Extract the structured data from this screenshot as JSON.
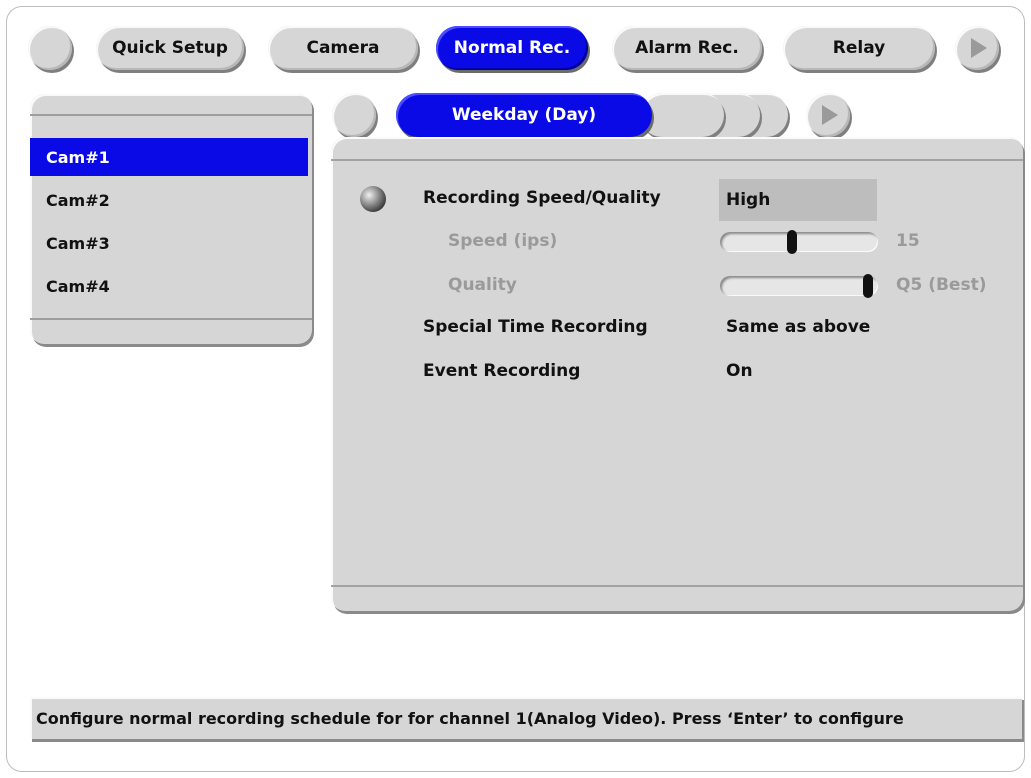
{
  "tabs": [
    {
      "label": "Quick Setup",
      "active": false
    },
    {
      "label": "Camera",
      "active": false
    },
    {
      "label": "Normal Rec.",
      "active": true
    },
    {
      "label": "Alarm Rec.",
      "active": false
    },
    {
      "label": "Relay",
      "active": false
    }
  ],
  "cameras": [
    {
      "label": "Cam#1",
      "selected": true
    },
    {
      "label": "Cam#2",
      "selected": false
    },
    {
      "label": "Cam#3",
      "selected": false
    },
    {
      "label": "Cam#4",
      "selected": false
    }
  ],
  "schedule_tabs": {
    "active_label": "Weekday (Day)"
  },
  "settings": {
    "recording_speed_quality": {
      "label": "Recording Speed/Quality",
      "value": "High"
    },
    "speed": {
      "label": "Speed (ips)",
      "value": "15",
      "level_percent": 45
    },
    "quality": {
      "label": "Quality",
      "value": "Q5 (Best)",
      "level_percent": 100
    },
    "special_time_recording": {
      "label": "Special Time Recording",
      "value": "Same as above"
    },
    "event_recording": {
      "label": "Event Recording",
      "value": "On"
    }
  },
  "status_text": "Configure normal recording schedule for for channel 1(Analog Video). Press ‘Enter’ to configure",
  "colors": {
    "accent": "#0a0ae6",
    "panel": "#d6d6d6",
    "disabled_text": "#9a9a9a"
  },
  "icons": {
    "nav_left": "circle-button-icon",
    "nav_right": "play-arrow-icon",
    "row_indicator": "ball-icon"
  }
}
